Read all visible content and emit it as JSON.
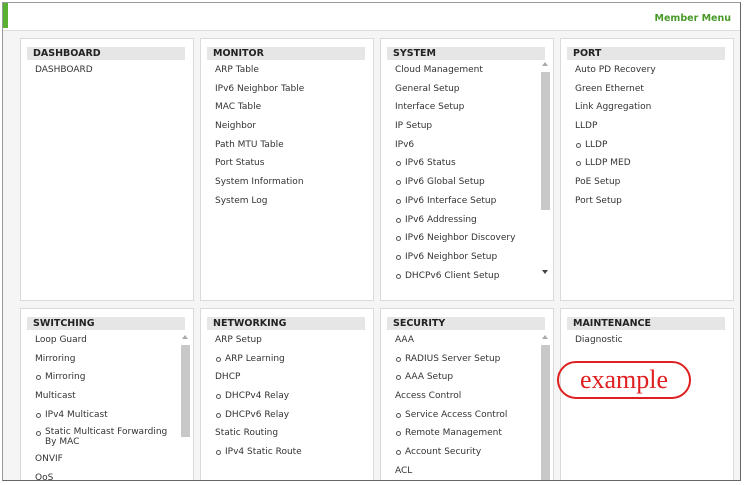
{
  "header": {
    "member_menu": "Member Menu"
  },
  "cards": {
    "dashboard": {
      "title": "DASHBOARD",
      "items": [
        "DASHBOARD"
      ]
    },
    "monitor": {
      "title": "MONITOR",
      "items": [
        "ARP Table",
        "IPv6 Neighbor Table",
        "MAC Table",
        "Neighbor",
        "Path MTU Table",
        "Port Status",
        "System Information",
        "System Log"
      ]
    },
    "system": {
      "title": "SYSTEM",
      "items": [
        "Cloud Management",
        "General Setup",
        "Interface Setup",
        "IP Setup",
        "IPv6",
        "IPv6 Status",
        "IPv6 Global Setup",
        "IPv6 Interface Setup",
        "IPv6 Addressing",
        "IPv6 Neighbor Discovery",
        "IPv6 Neighbor Setup",
        "DHCPv6 Client Setup"
      ]
    },
    "port": {
      "title": "PORT",
      "items": [
        "Auto PD Recovery",
        "Green Ethernet",
        "Link Aggregation",
        "LLDP",
        "LLDP",
        "LLDP MED",
        "PoE Setup",
        "Port Setup"
      ]
    },
    "switching": {
      "title": "SWITCHING",
      "items": [
        "Loop Guard",
        "Mirroring",
        "Mirroring",
        "Multicast",
        "IPv4 Multicast",
        "Static Multicast Forwarding By MAC",
        "ONVIF",
        "QoS"
      ]
    },
    "networking": {
      "title": "NETWORKING",
      "items": [
        "ARP Setup",
        "ARP Learning",
        "DHCP",
        "DHCPv4 Relay",
        "DHCPv6 Relay",
        "Static Routing",
        "IPv4 Static Route"
      ]
    },
    "security": {
      "title": "SECURITY",
      "items": [
        "AAA",
        "RADIUS Server Setup",
        "AAA Setup",
        "Access Control",
        "Service Access Control",
        "Remote Management",
        "Account Security",
        "ACL"
      ]
    },
    "maintenance": {
      "title": "MAINTENANCE",
      "items": [
        "Diagnostic"
      ]
    }
  },
  "annotation": {
    "stamp_text": "example"
  }
}
